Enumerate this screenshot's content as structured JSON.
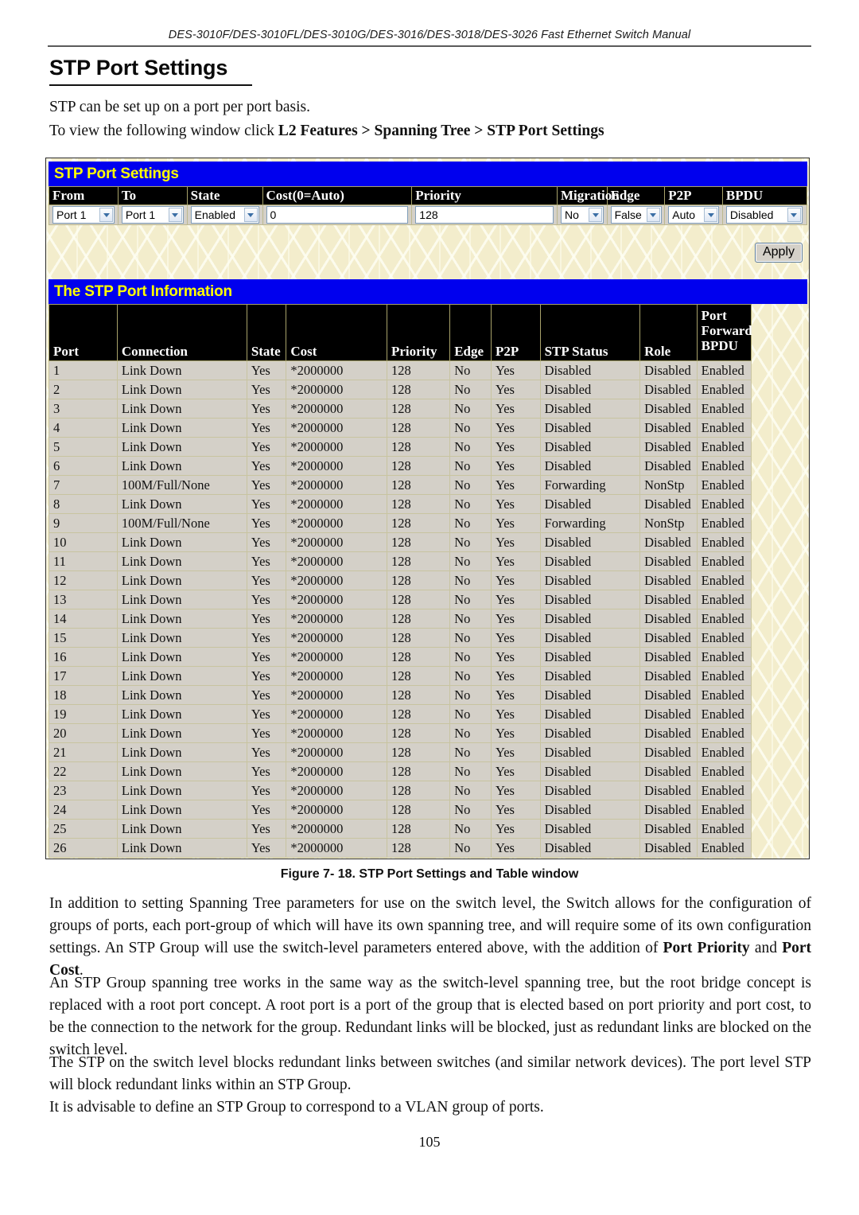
{
  "header": {
    "running_head": "DES-3010F/DES-3010FL/DES-3010G/DES-3016/DES-3018/DES-3026 Fast Ethernet Switch Manual"
  },
  "page_title": "STP Port Settings",
  "intro": {
    "line1": "STP can be set up on a port per port basis.",
    "line2_prefix": "To view the following window click ",
    "line2_bold": "L2 Features > Spanning Tree > STP Port Settings"
  },
  "screenshot": {
    "settings_panel": {
      "title": "STP Port Settings",
      "columns": [
        "From",
        "To",
        "State",
        "Cost(0=Auto)",
        "Priority",
        "Migration",
        "Edge",
        "P2P",
        "BPDU"
      ],
      "fields": {
        "from": {
          "value": "Port 1",
          "type": "select"
        },
        "to": {
          "value": "Port 1",
          "type": "select"
        },
        "state": {
          "value": "Enabled",
          "type": "select"
        },
        "cost": {
          "value": "0",
          "type": "text"
        },
        "priority": {
          "value": "128",
          "type": "text"
        },
        "migration": {
          "value": "No",
          "type": "select"
        },
        "edge": {
          "value": "False",
          "type": "select"
        },
        "p2p": {
          "value": "Auto",
          "type": "select"
        },
        "bpdu": {
          "value": "Disabled",
          "type": "select"
        }
      },
      "apply_label": "Apply"
    },
    "info_panel": {
      "title": "The STP Port Information",
      "columns": [
        "Port",
        "Connection",
        "State",
        "Cost",
        "Priority",
        "Edge",
        "P2P",
        "STP Status",
        "Role",
        "Port Forward BPDU"
      ],
      "rows": [
        [
          "1",
          "Link Down",
          "Yes",
          "*2000000",
          "128",
          "No",
          "Yes",
          "Disabled",
          "Disabled",
          "Enabled"
        ],
        [
          "2",
          "Link Down",
          "Yes",
          "*2000000",
          "128",
          "No",
          "Yes",
          "Disabled",
          "Disabled",
          "Enabled"
        ],
        [
          "3",
          "Link Down",
          "Yes",
          "*2000000",
          "128",
          "No",
          "Yes",
          "Disabled",
          "Disabled",
          "Enabled"
        ],
        [
          "4",
          "Link Down",
          "Yes",
          "*2000000",
          "128",
          "No",
          "Yes",
          "Disabled",
          "Disabled",
          "Enabled"
        ],
        [
          "5",
          "Link Down",
          "Yes",
          "*2000000",
          "128",
          "No",
          "Yes",
          "Disabled",
          "Disabled",
          "Enabled"
        ],
        [
          "6",
          "Link Down",
          "Yes",
          "*2000000",
          "128",
          "No",
          "Yes",
          "Disabled",
          "Disabled",
          "Enabled"
        ],
        [
          "7",
          "100M/Full/None",
          "Yes",
          "*2000000",
          "128",
          "No",
          "Yes",
          "Forwarding",
          "NonStp",
          "Enabled"
        ],
        [
          "8",
          "Link Down",
          "Yes",
          "*2000000",
          "128",
          "No",
          "Yes",
          "Disabled",
          "Disabled",
          "Enabled"
        ],
        [
          "9",
          "100M/Full/None",
          "Yes",
          "*2000000",
          "128",
          "No",
          "Yes",
          "Forwarding",
          "NonStp",
          "Enabled"
        ],
        [
          "10",
          "Link Down",
          "Yes",
          "*2000000",
          "128",
          "No",
          "Yes",
          "Disabled",
          "Disabled",
          "Enabled"
        ],
        [
          "11",
          "Link Down",
          "Yes",
          "*2000000",
          "128",
          "No",
          "Yes",
          "Disabled",
          "Disabled",
          "Enabled"
        ],
        [
          "12",
          "Link Down",
          "Yes",
          "*2000000",
          "128",
          "No",
          "Yes",
          "Disabled",
          "Disabled",
          "Enabled"
        ],
        [
          "13",
          "Link Down",
          "Yes",
          "*2000000",
          "128",
          "No",
          "Yes",
          "Disabled",
          "Disabled",
          "Enabled"
        ],
        [
          "14",
          "Link Down",
          "Yes",
          "*2000000",
          "128",
          "No",
          "Yes",
          "Disabled",
          "Disabled",
          "Enabled"
        ],
        [
          "15",
          "Link Down",
          "Yes",
          "*2000000",
          "128",
          "No",
          "Yes",
          "Disabled",
          "Disabled",
          "Enabled"
        ],
        [
          "16",
          "Link Down",
          "Yes",
          "*2000000",
          "128",
          "No",
          "Yes",
          "Disabled",
          "Disabled",
          "Enabled"
        ],
        [
          "17",
          "Link Down",
          "Yes",
          "*2000000",
          "128",
          "No",
          "Yes",
          "Disabled",
          "Disabled",
          "Enabled"
        ],
        [
          "18",
          "Link Down",
          "Yes",
          "*2000000",
          "128",
          "No",
          "Yes",
          "Disabled",
          "Disabled",
          "Enabled"
        ],
        [
          "19",
          "Link Down",
          "Yes",
          "*2000000",
          "128",
          "No",
          "Yes",
          "Disabled",
          "Disabled",
          "Enabled"
        ],
        [
          "20",
          "Link Down",
          "Yes",
          "*2000000",
          "128",
          "No",
          "Yes",
          "Disabled",
          "Disabled",
          "Enabled"
        ],
        [
          "21",
          "Link Down",
          "Yes",
          "*2000000",
          "128",
          "No",
          "Yes",
          "Disabled",
          "Disabled",
          "Enabled"
        ],
        [
          "22",
          "Link Down",
          "Yes",
          "*2000000",
          "128",
          "No",
          "Yes",
          "Disabled",
          "Disabled",
          "Enabled"
        ],
        [
          "23",
          "Link Down",
          "Yes",
          "*2000000",
          "128",
          "No",
          "Yes",
          "Disabled",
          "Disabled",
          "Enabled"
        ],
        [
          "24",
          "Link Down",
          "Yes",
          "*2000000",
          "128",
          "No",
          "Yes",
          "Disabled",
          "Disabled",
          "Enabled"
        ],
        [
          "25",
          "Link Down",
          "Yes",
          "*2000000",
          "128",
          "No",
          "Yes",
          "Disabled",
          "Disabled",
          "Enabled"
        ],
        [
          "26",
          "Link Down",
          "Yes",
          "*2000000",
          "128",
          "No",
          "Yes",
          "Disabled",
          "Disabled",
          "Enabled"
        ]
      ]
    }
  },
  "caption": "Figure 7- 18.  STP Port Settings and Table window",
  "body": {
    "p1_a": "In addition to setting Spanning Tree parameters for use on the switch level, the Switch allows for the configuration of groups of ports, each port-group of which will have its own spanning tree, and will require some of its own configuration settings. An STP Group will use the switch-level parameters entered above, with the addition of ",
    "p1_b1": "Port Priority",
    "p1_c": " and ",
    "p1_b2": "Port Cost",
    "p1_d": ".",
    "p2": "An STP Group spanning tree works in the same way as the switch-level spanning tree, but the root bridge concept is replaced with a root port concept. A root port is a port of the group that is elected based on port priority and port cost, to be the connection to the network for the group. Redundant links will be blocked, just as redundant links are blocked on the switch level.",
    "p3": "The STP on the switch level blocks redundant links between switches (and similar network devices). The port level STP will block redundant links within an STP Group.",
    "p4": "It is advisable to define an STP Group to correspond to a VLAN group of ports."
  },
  "page_number": "105",
  "colors": {
    "panel_title_bg": "#0000ee",
    "panel_title_fg": "#ffff00",
    "table_header_bg": "#000000",
    "table_row_bg": "#d4d0c8",
    "page_bg": "#f4eecd"
  }
}
